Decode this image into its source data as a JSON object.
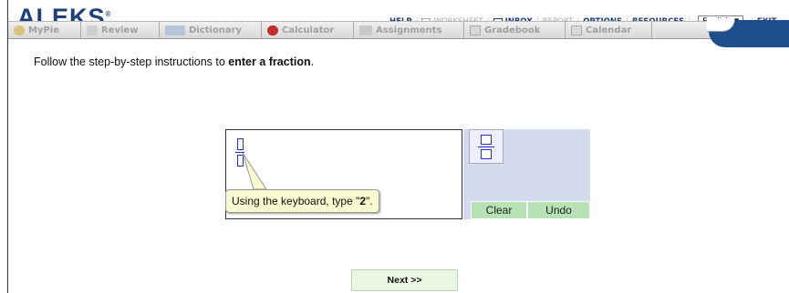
{
  "header": {
    "logo": "ALEKS",
    "logo_mark": "®",
    "links": {
      "help": "HELP",
      "worksheet": "WORKSHEET",
      "inbox": "INBOX",
      "report": "REPORT",
      "options": "OPTIONS",
      "resources": "RESOURCES",
      "exit": "EXIT"
    },
    "language": "English ▼"
  },
  "menu": {
    "items": [
      {
        "label": "MyPie",
        "icon": "pie-icon"
      },
      {
        "label": "Review",
        "icon": "check-icon"
      },
      {
        "label": "Dictionary",
        "icon": "book-icon"
      },
      {
        "label": "Calculator",
        "icon": "no-calculator-icon"
      },
      {
        "label": "Assignments",
        "icon": "pencil-icon"
      },
      {
        "label": "Gradebook",
        "icon": "gradebook-icon"
      },
      {
        "label": "Calendar",
        "icon": "calendar-icon"
      }
    ]
  },
  "main": {
    "instruction_prefix": "Follow the step-by-step instructions to ",
    "instruction_bold": "enter a fraction",
    "instruction_suffix": ".",
    "tooltip_prefix": "Using the keyboard, type \"",
    "tooltip_bold": "2",
    "tooltip_suffix": "\".",
    "clear_label": "Clear",
    "undo_label": "Undo",
    "next_label": "Next >>"
  },
  "colors": {
    "brand": "#1e3f78",
    "palette_bg": "#d3dbec",
    "button_green": "#b6e2b6",
    "tooltip_bg": "#fafad0"
  }
}
